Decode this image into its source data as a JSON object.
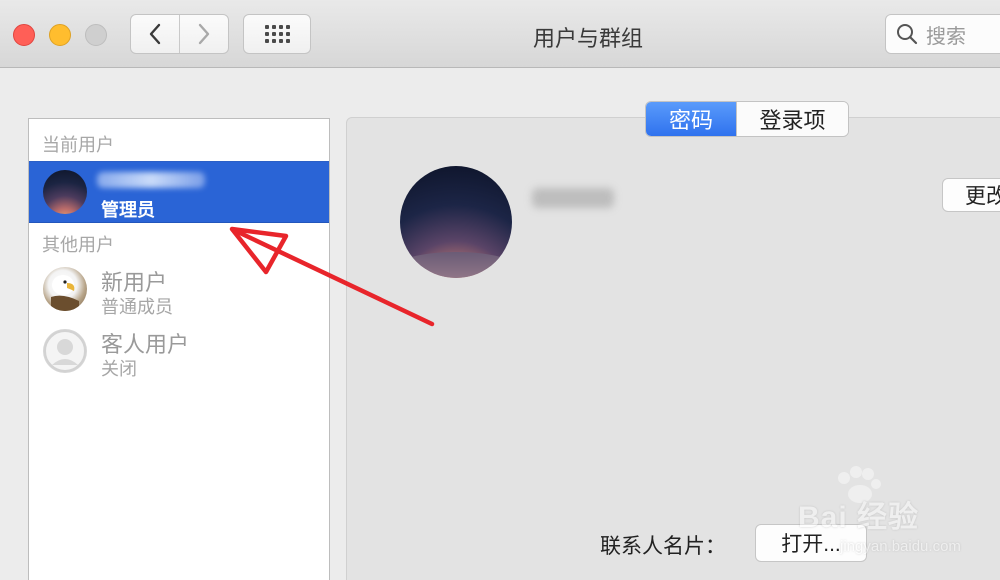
{
  "window": {
    "title": "用户与群组"
  },
  "toolbar": {
    "search_placeholder": "搜索",
    "back_icon": "chevron-left-icon",
    "forward_icon": "chevron-right-icon",
    "grid_icon": "grid-icon"
  },
  "sidebar": {
    "current_users_label": "当前用户",
    "current_user": {
      "role": "管理员"
    },
    "other_users_label": "其他用户",
    "other_users": [
      {
        "name": "新用户",
        "role": "普通成员"
      },
      {
        "name": "客人用户",
        "role": "关闭"
      }
    ]
  },
  "main": {
    "tabs": [
      {
        "label": "密码",
        "active": true
      },
      {
        "label": "登录项",
        "active": false
      }
    ],
    "change_button_label": "更改",
    "contact_card_label": "联系人名片：",
    "open_button_label": "打开..."
  },
  "watermark": {
    "text": "Bai 经验",
    "url": "jingyan.baidu.com"
  },
  "colors": {
    "selection": "#2a64d6",
    "tab_active": "#2f72ee",
    "annotation_arrow": "#e8252b",
    "close": "#ff5f57",
    "minimize": "#ffbd2e"
  }
}
